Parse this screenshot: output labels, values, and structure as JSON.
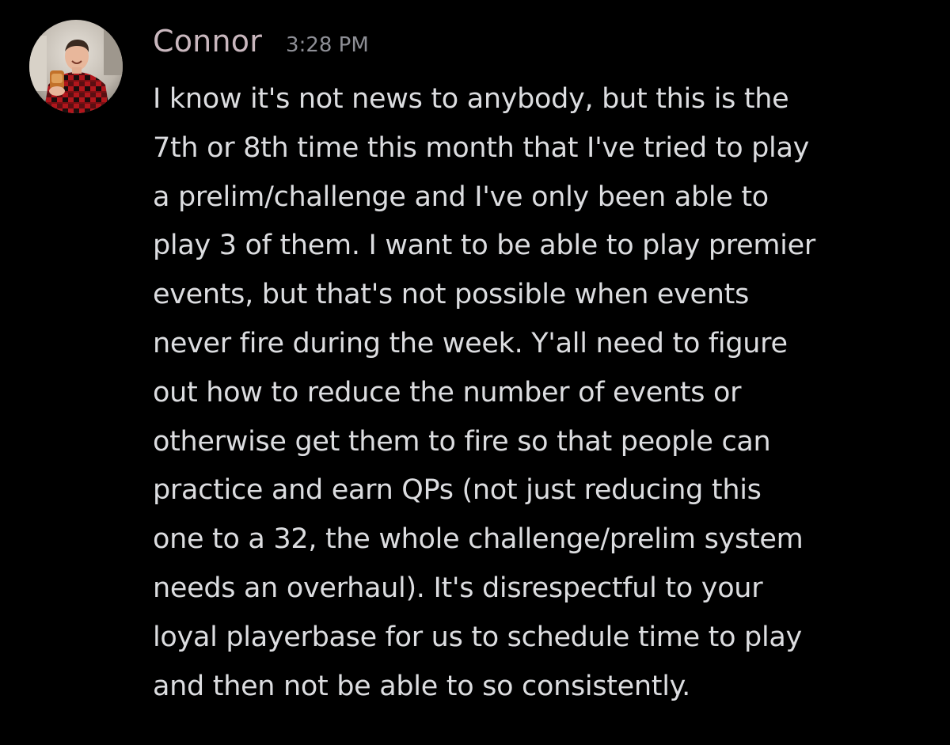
{
  "message": {
    "author": {
      "name": "Connor",
      "avatar_icon": "user-avatar-photo",
      "name_color": "#c9b7be"
    },
    "timestamp": "3:28 PM",
    "lines": [
      "I know it's not news to anybody, but this is the",
      "7th or 8th time this month that I've tried to play",
      "a prelim/challenge and I've only been able to",
      "play 3 of them. I want to be able to play premier",
      "events, but that's not possible when events",
      "never fire during the week. Y'all need to figure",
      "out how to reduce the number of events or",
      "otherwise get them to fire so that people can",
      "practice and earn QPs (not just reducing this",
      "one to a 32, the whole challenge/prelim system",
      "needs an overhaul). It's disrespectful to your",
      "loyal playerbase for us to schedule time to play",
      "and then not be able to so consistently."
    ]
  },
  "colors": {
    "background": "#000000",
    "message_text": "#dcdde0",
    "timestamp": "#8e8f96"
  }
}
